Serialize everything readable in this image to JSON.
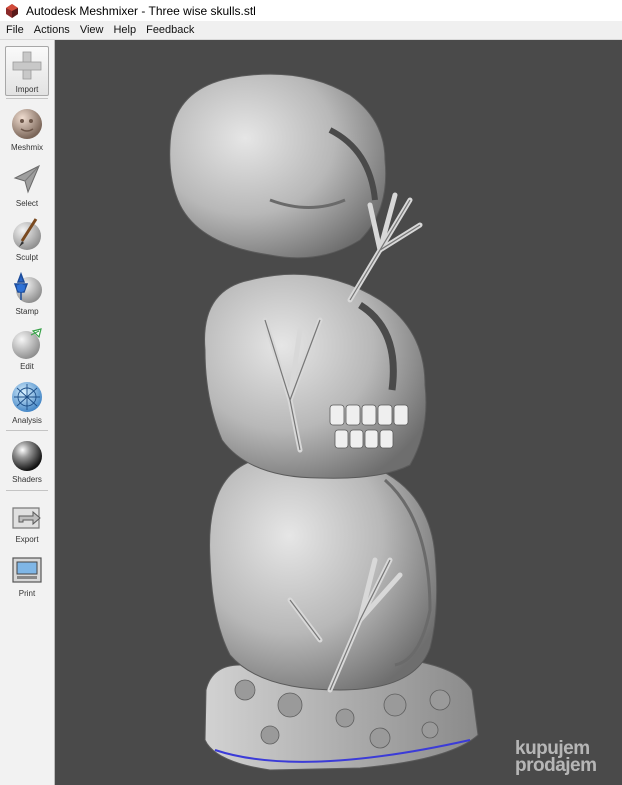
{
  "window": {
    "title": "Autodesk Meshmixer - Three wise skulls.stl",
    "app_icon": "meshmixer-logo-icon"
  },
  "menu": [
    "File",
    "Actions",
    "View",
    "Help",
    "Feedback"
  ],
  "toolbar": {
    "tools": [
      {
        "label": "Import",
        "icon": "plus-icon"
      },
      {
        "label": "Meshmix",
        "icon": "meshmix-sphere-icon"
      },
      {
        "label": "Select",
        "icon": "select-arrow-icon"
      },
      {
        "label": "Sculpt",
        "icon": "sculpt-brush-icon"
      },
      {
        "label": "Stamp",
        "icon": "stamp-icon"
      },
      {
        "label": "Edit",
        "icon": "edit-icon"
      },
      {
        "label": "Analysis",
        "icon": "analysis-icon"
      },
      {
        "label": "Shaders",
        "icon": "shaders-sphere-icon"
      },
      {
        "label": "Export",
        "icon": "export-icon"
      },
      {
        "label": "Print",
        "icon": "print-icon"
      }
    ]
  },
  "viewport": {
    "background": "#4a4a4a",
    "model": "three-wise-skulls-mesh"
  },
  "watermark": {
    "line1": "kupujem",
    "line2": "prodajem"
  }
}
